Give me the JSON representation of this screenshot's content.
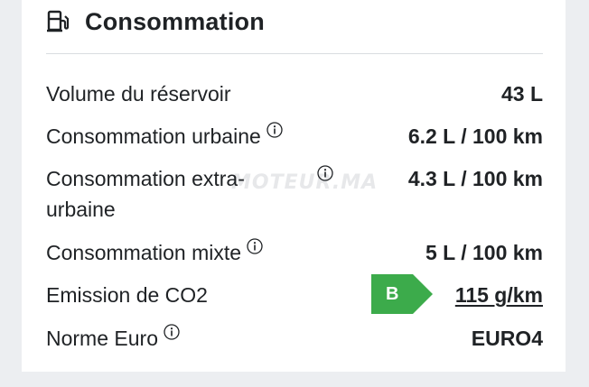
{
  "section": {
    "title": "Consommation",
    "icon": "fuel-pump-icon"
  },
  "rows": [
    {
      "label": "Volume du réservoir",
      "value": "43 L"
    },
    {
      "label": "Consommation urbaine",
      "value": "6.2 L / 100 km",
      "info": "info-icon"
    },
    {
      "label_line1": "Consommation extra-",
      "label_line2": "urbaine",
      "value": "4.3 L / 100 km",
      "info": "info-icon"
    },
    {
      "label": "Consommation mixte",
      "value": "5 L / 100 km",
      "info": "info-icon"
    },
    {
      "label": "Emission de CO2",
      "value": "115 g/km",
      "badge": "B",
      "badge_color": "#3cab4b"
    },
    {
      "label": "Norme Euro",
      "value": "EURO4",
      "info": "info-icon"
    }
  ],
  "watermark": "MOTEUR.MA"
}
